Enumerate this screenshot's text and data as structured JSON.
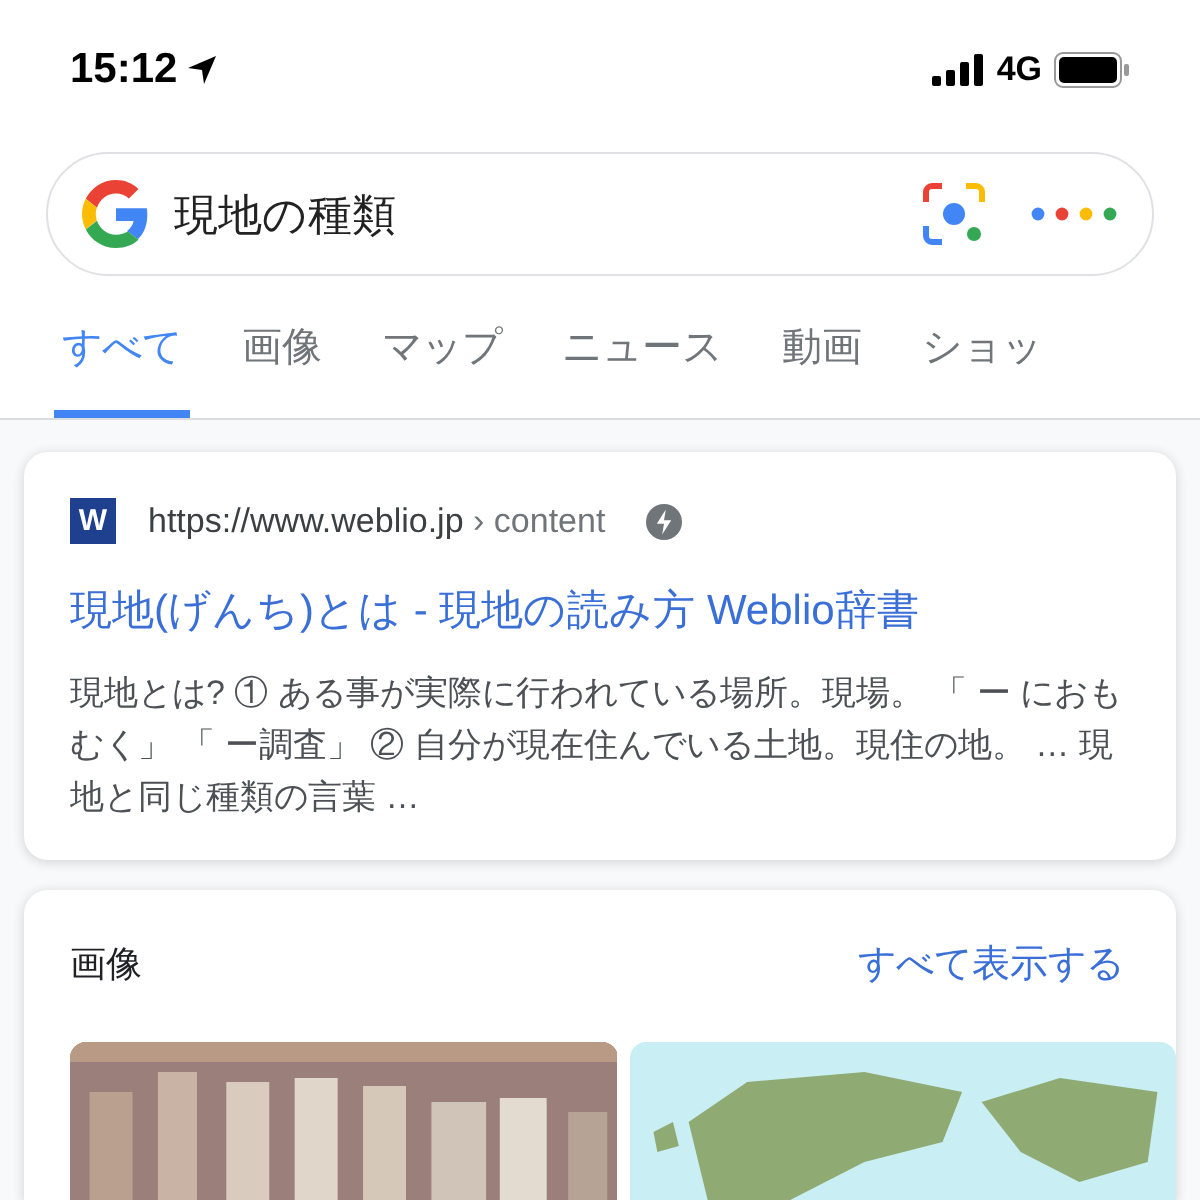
{
  "status_bar": {
    "time": "15:12",
    "network": "4G"
  },
  "search": {
    "value": "現地の種類"
  },
  "tabs": [
    {
      "label": "すべて",
      "selected": true
    },
    {
      "label": "画像",
      "selected": false
    },
    {
      "label": "マップ",
      "selected": false
    },
    {
      "label": "ニュース",
      "selected": false
    },
    {
      "label": "動画",
      "selected": false
    },
    {
      "label": "ショッ",
      "selected": false
    }
  ],
  "result": {
    "favicon": "W",
    "url": "https://www.weblio.jp",
    "path": "› content",
    "title": "現地(げんち)とは - 現地の読み方 Weblio辞書",
    "snippet": "現地とは? ① ある事が実際に行われている場所。現場。 「 ー におもむく」 「 ー調査」 ② 自分が現在住んでいる土地。現住の地。 … 現地と同じ種類の言葉 …"
  },
  "images": {
    "title": "画像",
    "link": "すべて表示する",
    "items": [
      {
        "kind": "bottles"
      },
      {
        "kind": "map"
      }
    ]
  }
}
